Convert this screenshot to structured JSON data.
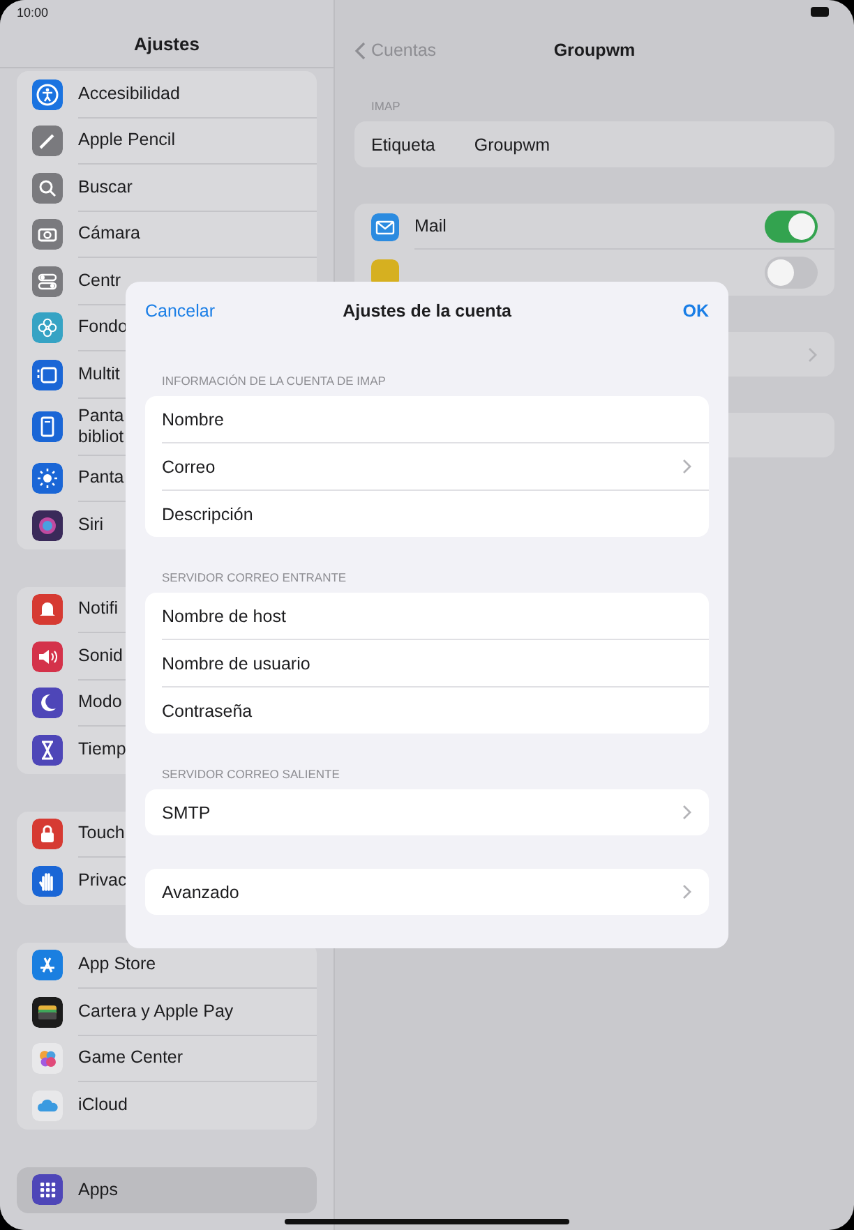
{
  "status_bar": {
    "time": "10:00"
  },
  "sidebar": {
    "title": "Ajustes",
    "groups": [
      {
        "items": [
          {
            "label": "Accesibilidad",
            "color": "#1a73e0",
            "selected": false
          },
          {
            "label": "Apple Pencil",
            "color": "#7a7a7e",
            "selected": false
          },
          {
            "label": "Buscar",
            "color": "#7a7a7e",
            "selected": false
          },
          {
            "label": "Cámara",
            "color": "#7a7a7e",
            "selected": false
          },
          {
            "label": "Centr",
            "color": "#7a7a7e",
            "selected": false
          },
          {
            "label": "Fondo",
            "color": "#36a3c4",
            "selected": false
          },
          {
            "label": "Multit",
            "color": "#1a66d6",
            "selected": false
          },
          {
            "label": "Panta\nbibliot",
            "color": "#1a66d6",
            "selected": false
          },
          {
            "label": "Panta",
            "color": "#1a66d6",
            "selected": false
          },
          {
            "label": "Siri",
            "color": "#3a2a5a",
            "selected": false
          }
        ]
      },
      {
        "items": [
          {
            "label": "Notifi",
            "color": "#d63a32",
            "selected": false
          },
          {
            "label": "Sonid",
            "color": "#d4324a",
            "selected": false
          },
          {
            "label": "Modo",
            "color": "#4e46b8",
            "selected": false
          },
          {
            "label": "Tiemp",
            "color": "#4e46b8",
            "selected": false
          }
        ]
      },
      {
        "items": [
          {
            "label": "Touch",
            "color": "#d63a32",
            "selected": false
          },
          {
            "label": "Privac",
            "color": "#1a66d6",
            "selected": false
          }
        ]
      },
      {
        "items": [
          {
            "label": "App Store",
            "color": "#1a7fe0",
            "selected": false
          },
          {
            "label": "Cartera y Apple Pay",
            "color": "#1c1c1c",
            "selected": false
          },
          {
            "label": "Game Center",
            "color": "#e8e8ea",
            "selected": false
          },
          {
            "label": "iCloud",
            "color": "#e8e8ea",
            "selected": false
          }
        ]
      },
      {
        "items": [
          {
            "label": "Apps",
            "color": "#4e46b8",
            "selected": true
          }
        ]
      }
    ]
  },
  "detail": {
    "back": "Cuentas",
    "title": "Groupwm",
    "section_header": "IMAP",
    "label_row": {
      "label": "Etiqueta",
      "value": "Groupwm"
    },
    "toggles": [
      {
        "label": "Mail",
        "color": "#2b8be0",
        "on": true
      },
      {
        "color": "#d6b020",
        "on": false
      }
    ]
  },
  "dialog": {
    "cancel": "Cancelar",
    "title": "Ajustes de la cuenta",
    "ok": "OK",
    "sections": [
      {
        "header": "INFORMACIÓN DE LA CUENTA DE IMAP",
        "rows": [
          {
            "label": "Nombre",
            "chevron": false
          },
          {
            "label": "Correo",
            "chevron": true
          },
          {
            "label": "Descripción",
            "chevron": false
          }
        ]
      },
      {
        "header": "SERVIDOR CORREO ENTRANTE",
        "rows": [
          {
            "label": "Nombre de host",
            "chevron": false
          },
          {
            "label": "Nombre de usuario",
            "chevron": false
          },
          {
            "label": "Contraseña",
            "chevron": false
          }
        ]
      },
      {
        "header": "SERVIDOR CORREO SALIENTE",
        "rows": [
          {
            "label": "SMTP",
            "chevron": true
          }
        ]
      },
      {
        "rows": [
          {
            "label": "Avanzado",
            "chevron": true
          }
        ]
      }
    ]
  }
}
